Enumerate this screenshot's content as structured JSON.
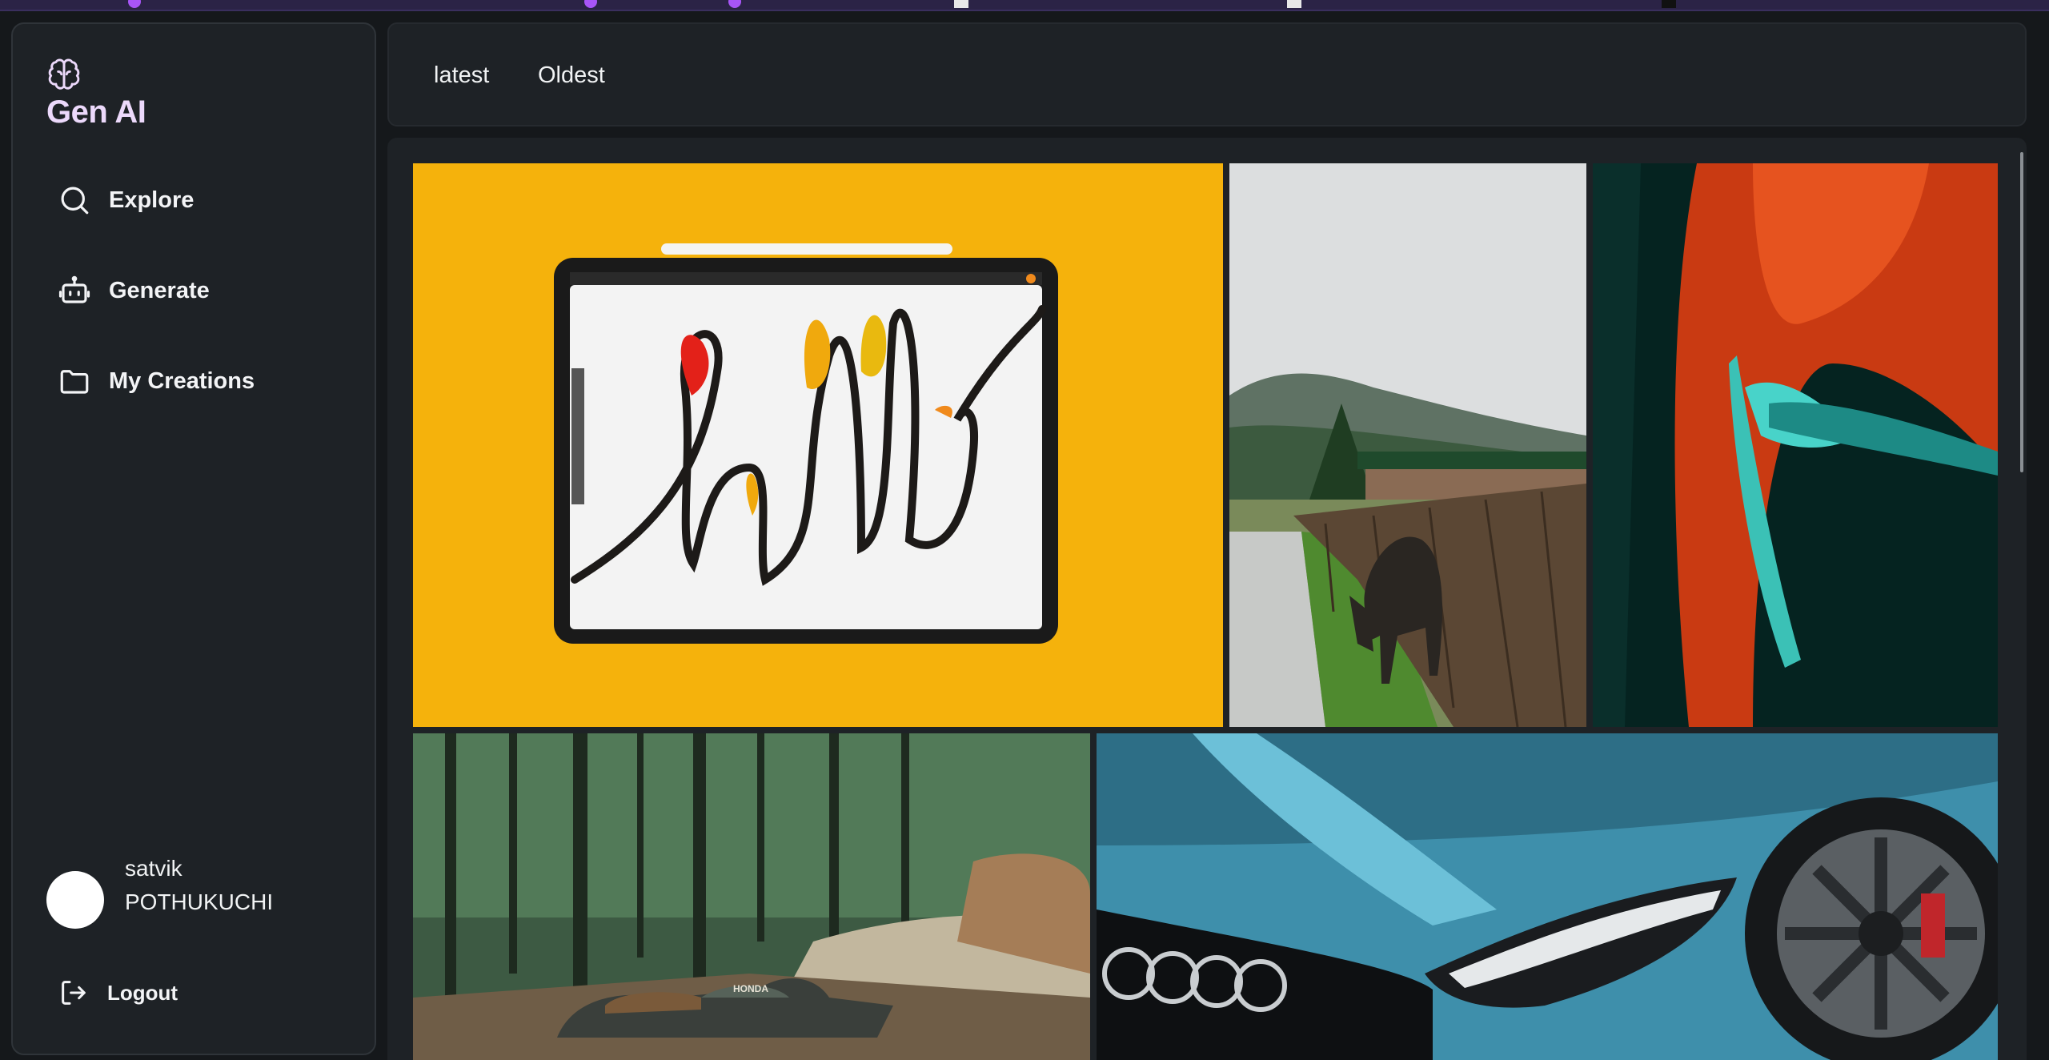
{
  "brand": {
    "title": "Gen AI"
  },
  "nav": {
    "explore": "Explore",
    "generate": "Generate",
    "my_creations": "My Creations"
  },
  "user": {
    "name_line1": "satvik",
    "name_line2": "POTHUKUCHI"
  },
  "logout": "Logout",
  "sort_tabs": {
    "latest": "latest",
    "oldest": "Oldest"
  },
  "gallery": {
    "images": [
      {
        "subject": "tablet with hello lettering on yellow background",
        "hello_text": "hello"
      },
      {
        "subject": "animal grazing by wooden fence near mountains"
      },
      {
        "subject": "red sports car close-up"
      },
      {
        "subject": "motorcycle on forest dirt road",
        "brand_text": "HONDA"
      },
      {
        "subject": "blue car headlight close-up"
      }
    ]
  },
  "colors": {
    "background": "#15181b",
    "panel": "#1e2226",
    "brand_text": "#ecd9fb",
    "topbar": "#2b2346"
  }
}
